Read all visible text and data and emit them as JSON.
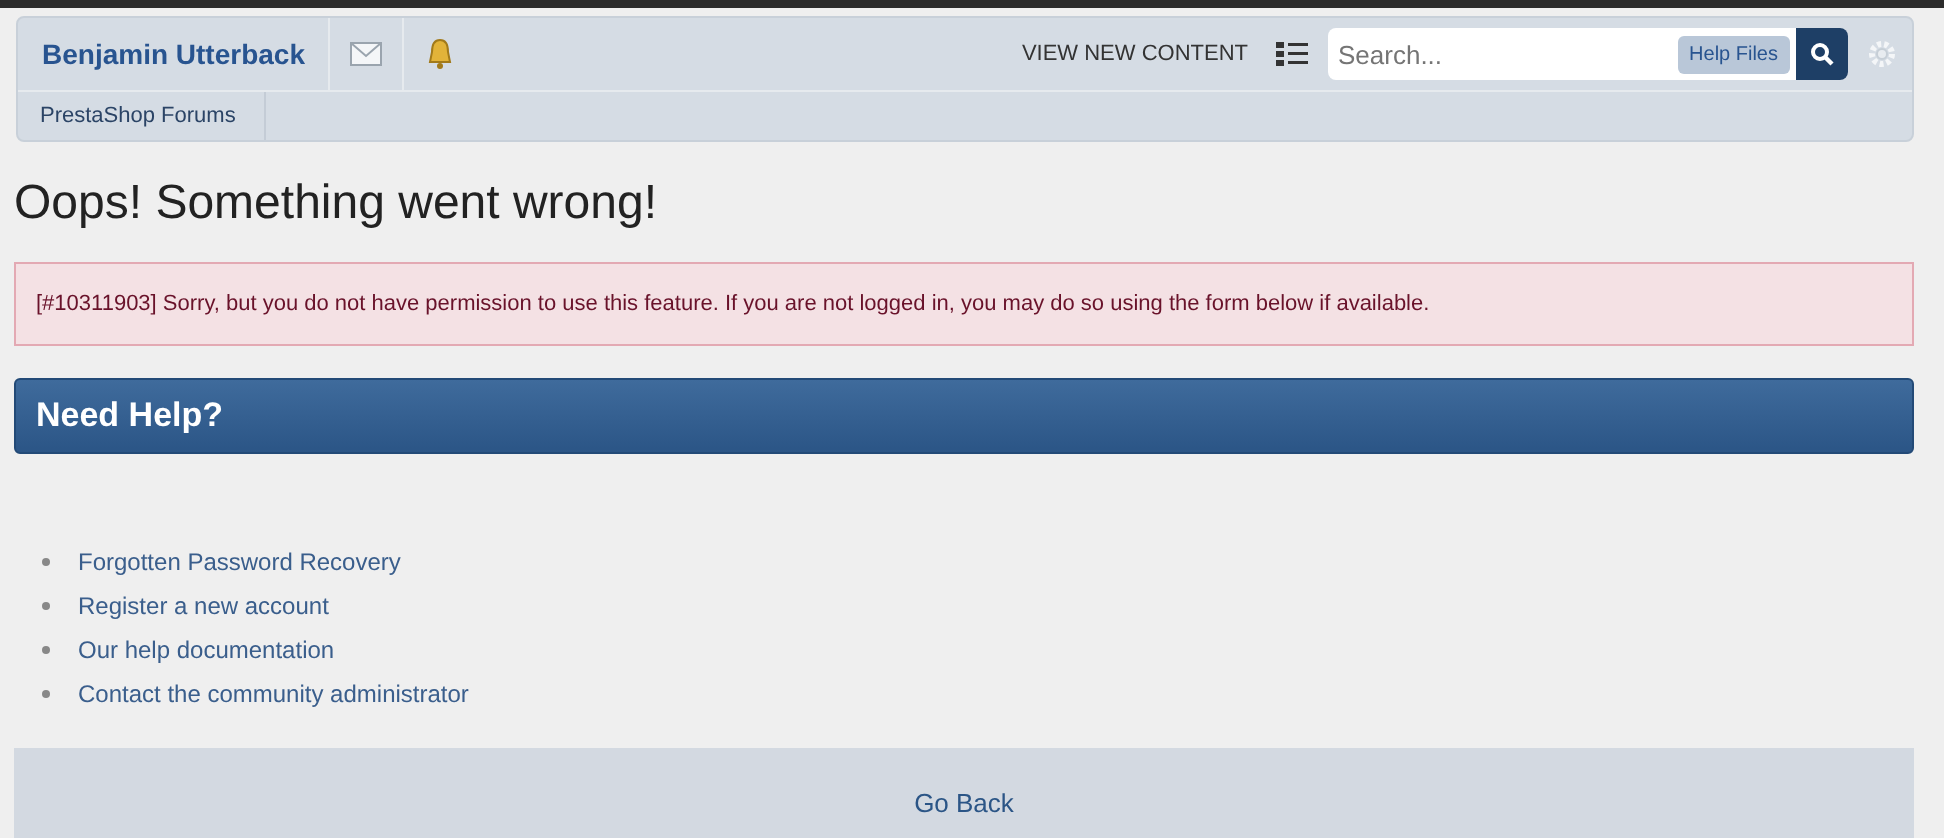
{
  "header": {
    "user_name": "Benjamin Utterback",
    "view_new_content": "VIEW NEW CONTENT",
    "search": {
      "placeholder": "Search..."
    },
    "search_scope": "Help Files"
  },
  "breadcrumb": [
    "PrestaShop Forums"
  ],
  "page_title": "Oops! Something went wrong!",
  "error_message": "[#10311903] Sorry, but you do not have permission to use this feature. If you are not logged in, you may do so using the form below if available.",
  "help_section": {
    "title": "Need Help?",
    "links": [
      "Forgotten Password Recovery",
      "Register a new account",
      "Our help documentation",
      "Contact the community administrator"
    ]
  },
  "go_back": "Go Back"
}
